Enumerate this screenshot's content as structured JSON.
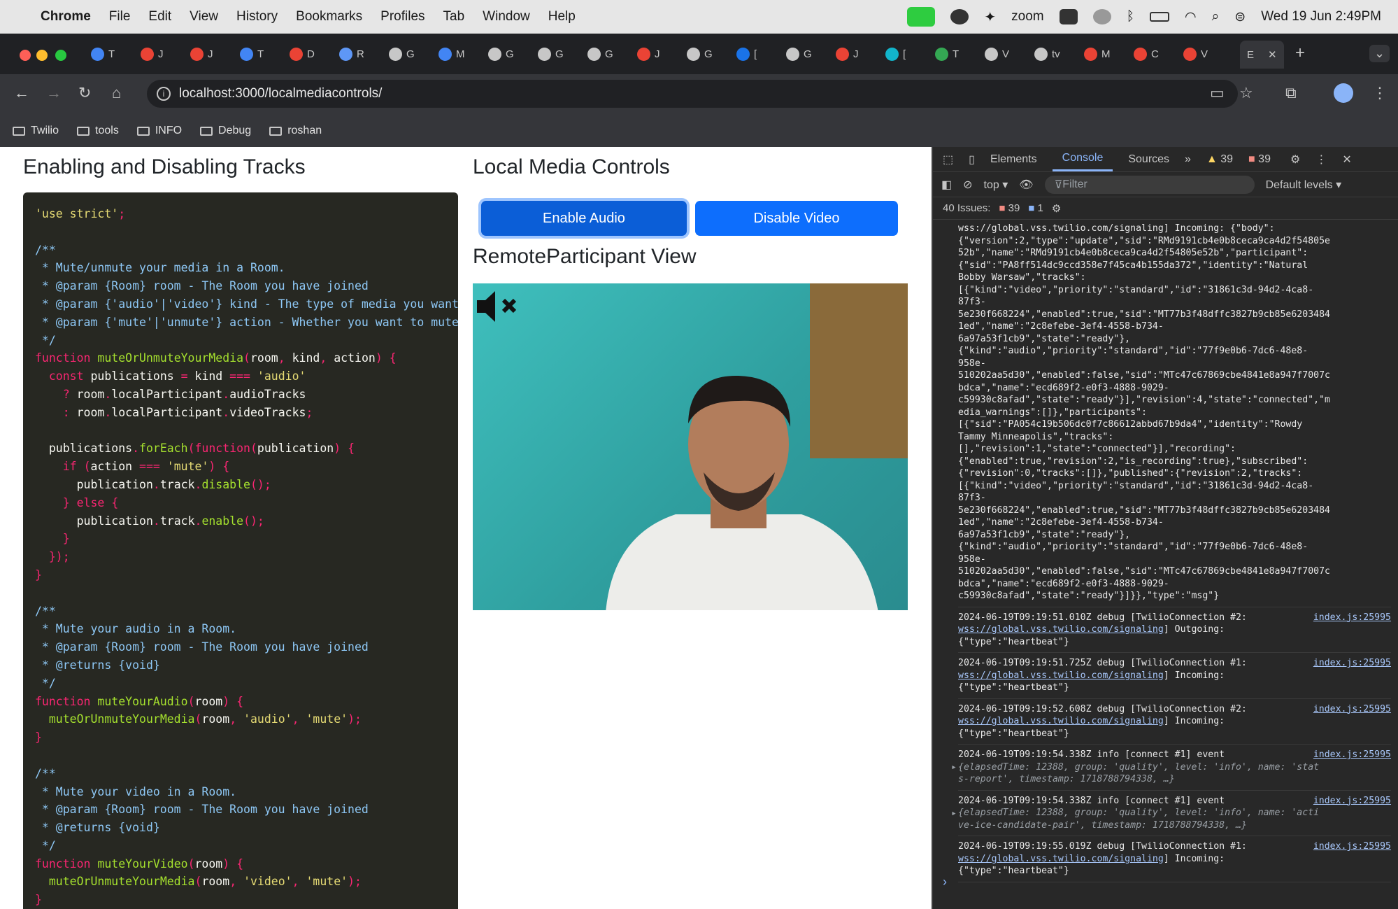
{
  "menubar": {
    "app": "Chrome",
    "items": [
      "File",
      "Edit",
      "View",
      "History",
      "Bookmarks",
      "Profiles",
      "Tab",
      "Window",
      "Help"
    ],
    "zoom": "zoom",
    "clock": "Wed 19 Jun  2:49PM"
  },
  "tabs": {
    "labels": [
      "T",
      "J",
      "J",
      "T",
      "D",
      "R",
      "G",
      "M",
      "G",
      "G",
      "G",
      "J",
      "G",
      "[",
      "G",
      "J",
      "[",
      "T",
      "V",
      "tv",
      "M",
      "C",
      "V"
    ],
    "active": "E"
  },
  "url": "localhost:3000/localmediacontrols/",
  "bookmarks": [
    "Twilio",
    "tools",
    "INFO",
    "Debug",
    "roshan"
  ],
  "page": {
    "heading_tracks": "Enabling and Disabling Tracks",
    "heading_controls": "Local Media Controls",
    "btn_audio": "Enable Audio",
    "btn_video": "Disable Video",
    "heading_remote": "RemoteParticipant View"
  },
  "devtools": {
    "tabs": [
      "Elements",
      "Console",
      "Sources"
    ],
    "warnings": "39",
    "errors": "39",
    "context": "top",
    "filter_placeholder": "Filter",
    "levels": "Default levels",
    "issues_label": "40 Issues:",
    "issues_warn": "39",
    "issues_info": "1"
  },
  "console_logs": [
    {
      "text": "wss://global.vss.twilio.com/signaling] Incoming: {\"body\":\n{\"version\":2,\"type\":\"update\",\"sid\":\"RMd9191cb4e0b8ceca9ca4d2f54805e\n52b\",\"name\":\"RMd9191cb4e0b8ceca9ca4d2f54805e52b\",\"participant\":\n{\"sid\":\"PA8ff514dc9ccd358e7f45ca4b155da372\",\"identity\":\"Natural\nBobby Warsaw\",\"tracks\":\n[{\"kind\":\"video\",\"priority\":\"standard\",\"id\":\"31861c3d-94d2-4ca8-\n87f3-\n5e230f668224\",\"enabled\":true,\"sid\":\"MT77b3f48dffc3827b9cb85e6203484\n1ed\",\"name\":\"2c8efebe-3ef4-4558-b734-\n6a97a53f1cb9\",\"state\":\"ready\"},\n{\"kind\":\"audio\",\"priority\":\"standard\",\"id\":\"77f9e0b6-7dc6-48e8-\n958e-\n510202aa5d30\",\"enabled\":false,\"sid\":\"MTc47c67869cbe4841e8a947f7007c\nbdca\",\"name\":\"ecd689f2-e0f3-4888-9029-\nc59930c8afad\",\"state\":\"ready\"}],\"revision\":4,\"state\":\"connected\",\"m\nedia_warnings\":[]},\"participants\":\n[{\"sid\":\"PA054c19b506dc0f7c86612abbd67b9da4\",\"identity\":\"Rowdy\nTammy Minneapolis\",\"tracks\":\n[],\"revision\":1,\"state\":\"connected\"}],\"recording\":\n{\"enabled\":true,\"revision\":2,\"is_recording\":true},\"subscribed\":\n{\"revision\":0,\"tracks\":[]},\"published\":{\"revision\":2,\"tracks\":\n[{\"kind\":\"video\",\"priority\":\"standard\",\"id\":\"31861c3d-94d2-4ca8-\n87f3-\n5e230f668224\",\"enabled\":true,\"sid\":\"MT77b3f48dffc3827b9cb85e6203484\n1ed\",\"name\":\"2c8efebe-3ef4-4558-b734-\n6a97a53f1cb9\",\"state\":\"ready\"},\n{\"kind\":\"audio\",\"priority\":\"standard\",\"id\":\"77f9e0b6-7dc6-48e8-\n958e-\n510202aa5d30\",\"enabled\":false,\"sid\":\"MTc47c67869cbe4841e8a947f7007c\nbdca\",\"name\":\"ecd689f2-e0f3-4888-9029-\nc59930c8afad\",\"state\":\"ready\"}]}},\"type\":\"msg\"}"
    },
    {
      "head": "2024-06-19T09:19:51.010Z debug [TwilioConnection #2:",
      "src": "index.js:25995",
      "link": "wss://global.vss.twilio.com/signaling",
      "tail": "] Outgoing:\n{\"type\":\"heartbeat\"}"
    },
    {
      "head": "2024-06-19T09:19:51.725Z debug [TwilioConnection #1:",
      "src": "index.js:25995",
      "link": "wss://global.vss.twilio.com/signaling",
      "tail": "] Incoming:\n{\"type\":\"heartbeat\"}"
    },
    {
      "head": "2024-06-19T09:19:52.608Z debug [TwilioConnection #2:",
      "src": "index.js:25995",
      "link": "wss://global.vss.twilio.com/signaling",
      "tail": "] Incoming:\n{\"type\":\"heartbeat\"}"
    },
    {
      "head": "2024-06-19T09:19:54.338Z info [connect #1] event",
      "src": "index.js:25995",
      "obj": "{elapsedTime: 12388, group: 'quality', level: 'info', name: 'stat\ns-report', timestamp: 1718788794338, …}"
    },
    {
      "head": "2024-06-19T09:19:54.338Z info [connect #1] event",
      "src": "index.js:25995",
      "obj": "{elapsedTime: 12388, group: 'quality', level: 'info', name: 'acti\nve-ice-candidate-pair', timestamp: 1718788794338, …}"
    },
    {
      "head": "2024-06-19T09:19:55.019Z debug [TwilioConnection #1:",
      "src": "index.js:25995",
      "link": "wss://global.vss.twilio.com/signaling",
      "tail": "] Incoming:\n{\"type\":\"heartbeat\"}"
    }
  ]
}
